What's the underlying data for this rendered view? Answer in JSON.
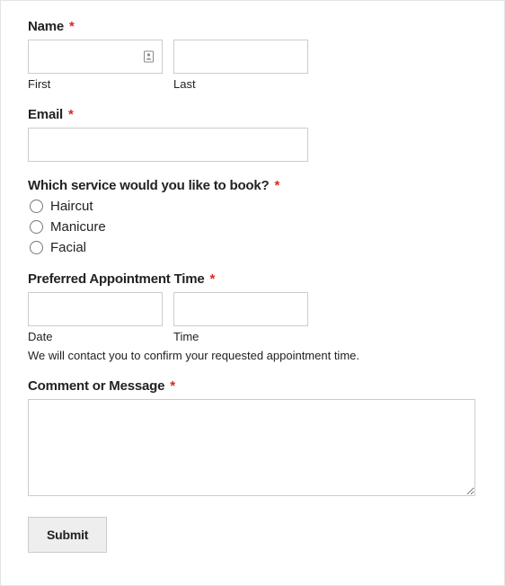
{
  "name": {
    "label": "Name",
    "first_sublabel": "First",
    "last_sublabel": "Last",
    "first_value": "",
    "last_value": ""
  },
  "email": {
    "label": "Email",
    "value": ""
  },
  "service": {
    "label": "Which service would you like to book?",
    "options": [
      {
        "label": "Haircut"
      },
      {
        "label": "Manicure"
      },
      {
        "label": "Facial"
      }
    ]
  },
  "appointment": {
    "label": "Preferred Appointment Time",
    "date_sublabel": "Date",
    "time_sublabel": "Time",
    "date_value": "",
    "time_value": "",
    "helper": "We will contact you to confirm your requested appointment time."
  },
  "comment": {
    "label": "Comment or Message",
    "value": ""
  },
  "submit": {
    "label": "Submit"
  },
  "asterisk": "*"
}
